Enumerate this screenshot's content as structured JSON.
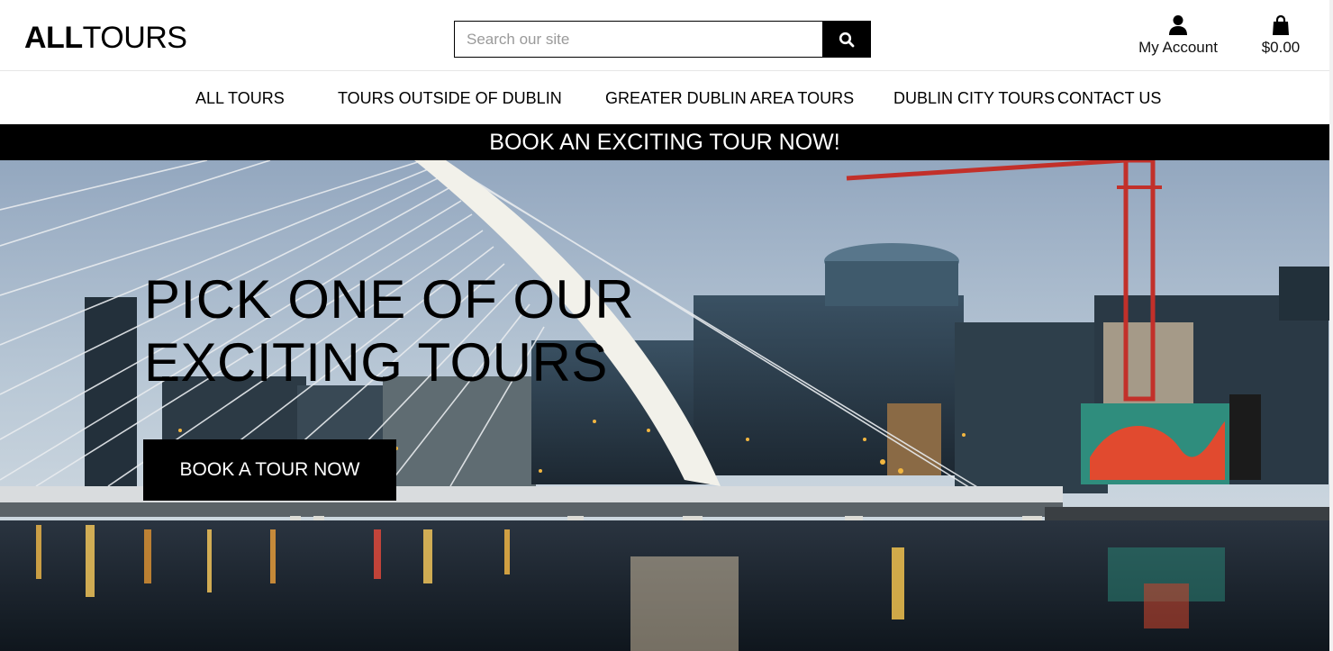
{
  "header": {
    "logo_bold": "ALL",
    "logo_light": "TOURS",
    "search": {
      "placeholder": "Search our site",
      "value": "",
      "button_icon": "search-icon"
    },
    "account": {
      "icon": "user-icon",
      "label": "My Account"
    },
    "cart": {
      "icon": "shopping-bag-icon",
      "total": "$0.00"
    }
  },
  "nav": {
    "items": [
      {
        "label": "ALL TOURS"
      },
      {
        "label": "TOURS OUTSIDE OF DUBLIN"
      },
      {
        "label": "GREATER DUBLIN AREA TOURS"
      },
      {
        "label": "DUBLIN CITY TOURS"
      },
      {
        "label": "CONTACT US"
      }
    ]
  },
  "banner": {
    "text": "BOOK AN EXCITING TOUR NOW!"
  },
  "hero": {
    "title_line1": "PICK ONE OF OUR",
    "title_line2": "EXCITING TOURS",
    "cta_label": "BOOK A TOUR NOW"
  },
  "colors": {
    "primary": "#000000",
    "background": "#ffffff",
    "banner_text": "#ffffff"
  }
}
